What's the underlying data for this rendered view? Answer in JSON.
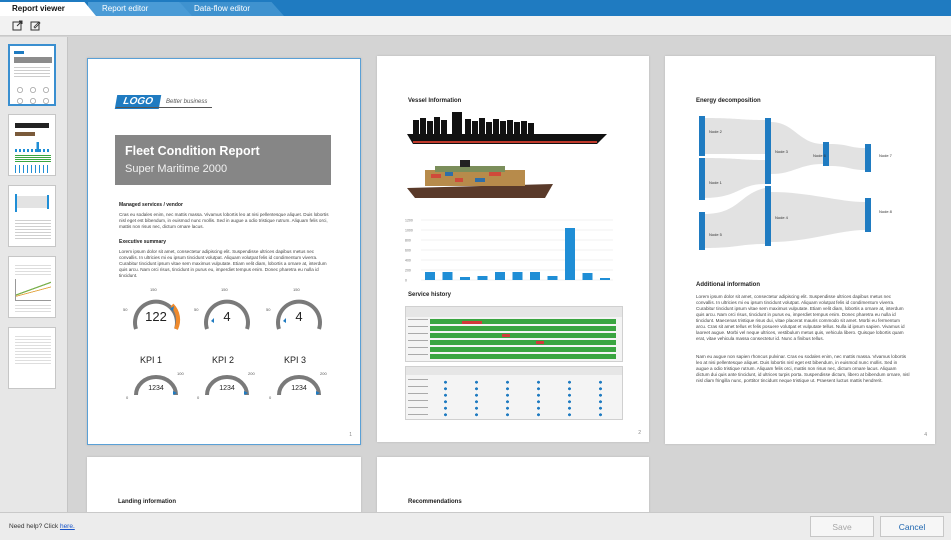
{
  "tabs": [
    {
      "label": "Report viewer"
    },
    {
      "label": "Report editor"
    },
    {
      "label": "Data-flow editor"
    }
  ],
  "toolbar": {
    "open_icon": "open-file-icon",
    "edit_icon": "edit-document-icon"
  },
  "sidebar": {
    "thumbnail_count": 5,
    "selected_index": 0
  },
  "pages": {
    "p1": {
      "logo": "LOGO",
      "tagline": "Better business",
      "title": "Fleet Condition Report",
      "subtitle": "Super Maritime 2000",
      "managed_heading": "Managed services / vendor",
      "managed_text": "Cras eu sodales enim, nec mattis massa. Vivamus lobortis leo at nisi pellentesque aliquet. Duis lobortis nisl eget est bibendum, in euismod nunc mollis. Sed in augue a odio tristique rutrum. Aliquam felis orci, mattis non risus nec, dictum ornare lacus.",
      "exec_heading": "Executive summary",
      "exec_text": "Lorem ipsum dolor sit amet, consectetur adipiscing elit. Suspendisse ultrices dapibus metus nec convallis. In ultricies mi eu ipsum tincidunt volutpat. Aliquam volutpat felis id condimentum viverra. Curabitur tincidunt ipsum vitae sem maximus vulputate. Etiam velit diam, lobortis a ornare at, interdum quis arcu. Nam orci risus, tincidunt in purus eu, imperdiet tempus enim. Donec pharetra eu nulla id tincidunt.",
      "gauges": [
        {
          "value": "122",
          "max": "150",
          "min": "50",
          "label": "KPI 1"
        },
        {
          "value": "4",
          "max": "150",
          "min": "50",
          "label": "KPI 2"
        },
        {
          "value": "4",
          "max": "150",
          "min": "50",
          "label": "KPI 3"
        }
      ],
      "small_gauges": [
        {
          "value": "1234",
          "max": "100",
          "min": "0"
        },
        {
          "value": "1234",
          "max": "200",
          "min": "0"
        },
        {
          "value": "1234",
          "max": "200",
          "min": "0"
        }
      ],
      "page_number": "1"
    },
    "p2": {
      "vessel_heading": "Vessel Information",
      "service_heading": "Service history",
      "page_number": "2",
      "chart_ticks": [
        "1200",
        "1000",
        "800",
        "600",
        "400",
        "200",
        "0"
      ]
    },
    "p3": {
      "energy_heading": "Energy decomposition",
      "nodes": [
        "Node 2",
        "Node 1",
        "Node 3",
        "Node 5",
        "Node 4",
        "Node 6",
        "Node 7",
        "Node 8"
      ],
      "additional_heading": "Additional information",
      "text1": "Lorem ipsum dolor sit amet, consectetur adipiscing elit. Suspendisse ultrices dapibus metus nec convallis. In ultricies mi eu ipsum tincidunt volutpat. Aliquam volutpat felis id condimentum viverra. Curabitur tincidunt ipsum vitae sem maximus vulputate. Etiam velit diam, lobortis a ornare at, interdum quis arcu. Nam orci risus, tincidunt in purus eu, imperdiet tempus enim. Donec pharetra eu nulla id tincidunt. Maecenas tristique risus dui, vitae placerat mauris commodo sit amet. Morbi eu fermentum arcu. Cras sit amet tellus et felis posuere volutpat et vulputate tellus. Nulla id ipsum sapien. Vivamus id laoreet augue. Morbi vel neque ultrices, vestibulum metus quis, vehicula libero. Quisque lobortis quam erat, vitae vehicula massa consectetur id. Nunc a finibus tellus.",
      "text2": "Nam eu augue non sapien rhoncus pulvinar. Cras eu sodales enim, nec mattis massa. Vivamus lobortis leo at nisi pellentesque aliquet. Duis lobortis nisl eget est bibendum, in euismod nunc mollis. Sed in augue a odio tristique rutrum. Aliquam felis orci, mattis non risus nec, dictum ornare lacus. Aliquam dictum dui quis ante tincidunt, id ultrices turpis porta. Suspendisse dictum, libero at bibendum ornare, nisl nisl diam fringilla nunc, porttitor tincidunt neque tristique ut. Praesent luctus mattis hendrerit.",
      "page_number": "4"
    },
    "p4": {
      "heading": "Landing information"
    },
    "p5": {
      "heading": "Recommendations"
    }
  },
  "footer": {
    "help_prefix": "Need help? Click ",
    "help_link": "here.",
    "save_label": "Save",
    "cancel_label": "Cancel"
  },
  "colors": {
    "accent": "#1f7bc1",
    "bar": "#1f8ed6",
    "gauge_orange": "#ef8a2c",
    "gantt_green": "#3aa541",
    "gantt_red": "#d03a3a"
  }
}
